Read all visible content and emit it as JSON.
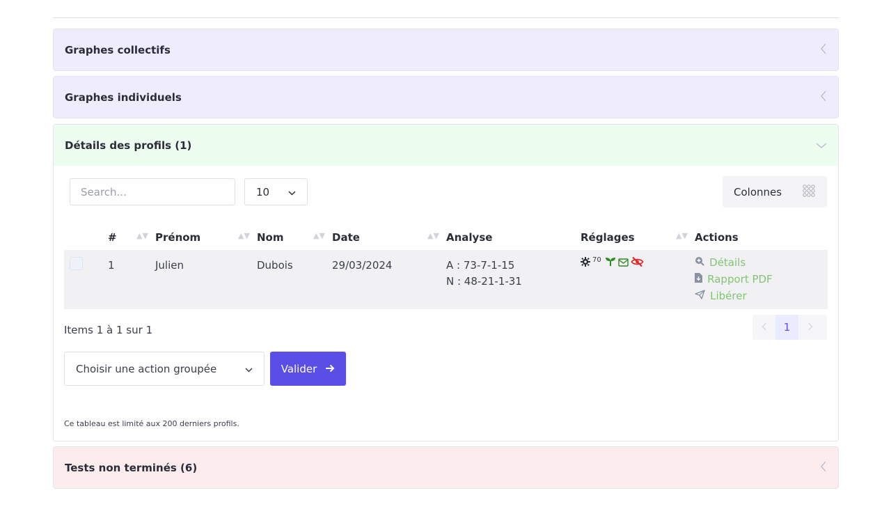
{
  "panels": {
    "collectifs": {
      "title": "Graphes collectifs"
    },
    "individuels": {
      "title": "Graphes individuels"
    },
    "profils": {
      "title": "Détails des profils (1)"
    },
    "tests": {
      "title": "Tests non terminés (6)"
    }
  },
  "toolbar": {
    "search_placeholder": "Search...",
    "page_length": "10",
    "columns_label": "Colonnes"
  },
  "table": {
    "headers": [
      "#",
      "Prénom",
      "Nom",
      "Date",
      "Analyse",
      "Réglages",
      "Actions"
    ],
    "rows": [
      {
        "num": "1",
        "prenom": "Julien",
        "nom": "Dubois",
        "date": "29/03/2024",
        "analyse_a": "A : 73-7-1-15",
        "analyse_n": "N : 48-21-1-31",
        "reglage_value": "70",
        "actions": {
          "details": "Détails",
          "rapport": "Rapport PDF",
          "liberer": "Libérer"
        }
      }
    ]
  },
  "footer": {
    "items_info": "Items 1 à 1 sur 1",
    "current_page": "1",
    "bulk_placeholder": "Choisir une action groupée",
    "validate_label": "Valider",
    "note": "Ce tableau est limité aux 200 derniers profils."
  },
  "colors": {
    "accent": "#5b4ee6",
    "link_green": "#82c572",
    "icon_green": "#2e8b22",
    "icon_red": "#e32727"
  }
}
